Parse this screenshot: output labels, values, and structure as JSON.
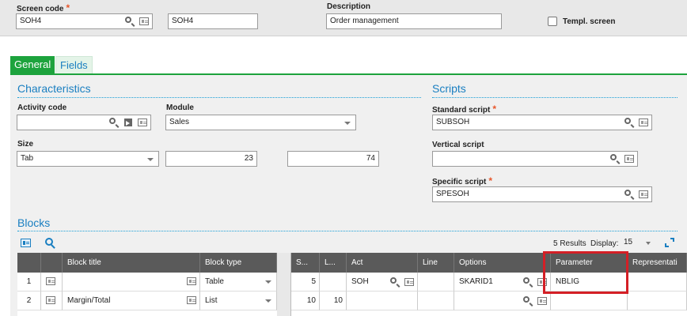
{
  "header": {
    "screen_code_label": "Screen code",
    "screen_code_value": "SOH4",
    "screen_code_copy": "SOH4",
    "description_label": "Description",
    "description_value": "Order management",
    "templ_label": "Templ. screen"
  },
  "tabs": [
    {
      "label": "General"
    },
    {
      "label": "Fields"
    }
  ],
  "characteristics": {
    "title": "Characteristics",
    "activity_label": "Activity code",
    "activity_value": "",
    "module_label": "Module",
    "module_value": "Sales",
    "size_label": "Size",
    "size_value": "Tab",
    "size_num1": "23",
    "size_num2": "74"
  },
  "scripts": {
    "title": "Scripts",
    "standard_label": "Standard script",
    "standard_value": "SUBSOH",
    "vertical_label": "Vertical script",
    "vertical_value": "",
    "specific_label": "Specific script",
    "specific_value": "SPESOH"
  },
  "blocks": {
    "title": "Blocks",
    "results": "5 Results",
    "display_label": "Display:",
    "display_value": "15",
    "columns": [
      "Block title",
      "Block type",
      "S...",
      "L...",
      "Act",
      "Line",
      "Options",
      "Parameter",
      "Representati"
    ],
    "rows": [
      {
        "num": "1",
        "title": "",
        "type": "Table",
        "s": "5",
        "l": "",
        "act": "SOH",
        "line": "",
        "options": "SKARID1",
        "parameter": "NBLIG",
        "rep": ""
      },
      {
        "num": "2",
        "title": "Margin/Total",
        "type": "List",
        "s": "10",
        "l": "10",
        "act": "",
        "line": "",
        "options": "",
        "parameter": "",
        "rep": ""
      }
    ]
  },
  "colors": {
    "accent": "#1da33d",
    "link": "#1a7fc1",
    "required": "#e8562a",
    "highlight": "#d41f26"
  }
}
